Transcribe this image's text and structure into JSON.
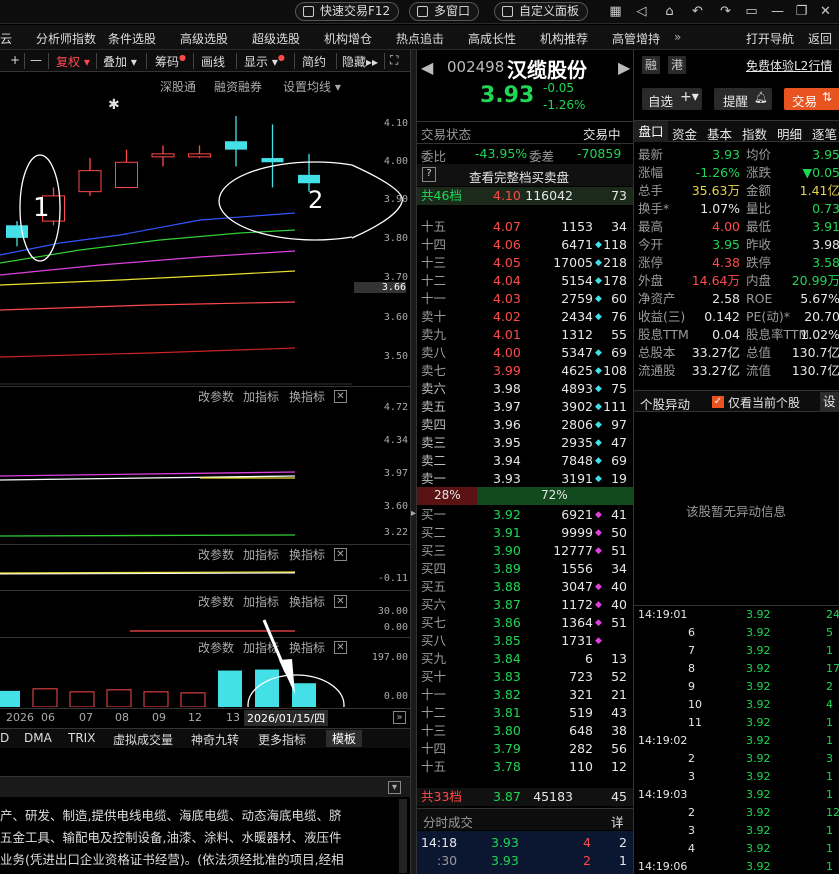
{
  "topbar": {
    "quick_trade": "快速交易F12",
    "multi_window": "多窗口",
    "custom_panel": "自定义面板"
  },
  "menu": {
    "items": [
      "云",
      "分析师指数",
      "条件选股",
      "高级选股",
      "超级选股",
      "机构增仓",
      "热点追击",
      "高成长性",
      "机构推荐",
      "高管增持"
    ],
    "nav": "打开导航",
    "back": "返回"
  },
  "chart_toolbar": {
    "fuquan": "复权",
    "diejia": "叠加",
    "chouma": "筹码",
    "huaxian": "画线",
    "xianshi": "显示",
    "jianyue": "简约",
    "yincang": "隐藏"
  },
  "chart_sub_toolbar": {
    "shengang": "深股通",
    "rongzi": "融资融券",
    "setup_ma": "设置均线"
  },
  "price_axis": [
    "4.10",
    "4.00",
    "3.90",
    "3.80",
    "3.70",
    "3.60",
    "3.50"
  ],
  "price_axis_current": "3.66",
  "indicator_panels": [
    {
      "labels": [
        "改参数",
        "加指标",
        "换指标"
      ],
      "axis": [
        "4.72",
        "4.34",
        "3.97",
        "3.60",
        "3.22"
      ]
    },
    {
      "labels": [
        "改参数",
        "加指标",
        "换指标"
      ],
      "axis": [
        "-0.11"
      ]
    },
    {
      "labels": [
        "改参数",
        "加指标",
        "换指标"
      ],
      "axis": [
        "30.00",
        "0.00"
      ]
    },
    {
      "labels": [
        "改参数",
        "加指标",
        "换指标"
      ],
      "axis": [
        "197.00",
        "0.00"
      ]
    }
  ],
  "date_axis": {
    "labels": [
      "2026",
      "06",
      "07",
      "08",
      "09",
      "12",
      "13"
    ],
    "current_date": "2026/01/15/四"
  },
  "indicator_tabs": [
    "D",
    "DMA",
    "TRIX",
    "虚拟成交量",
    "神奇九转",
    "更多指标",
    "模板"
  ],
  "annotations": {
    "one": "1",
    "two": "2"
  },
  "description": [
    "产、研发、制造,提供电线电缆、海底电缆、动态海底电缆、脐",
    "五金工具、输配电及控制设备,油漆、涂料、水暖器材、液压件",
    "业务(凭进出口企业资格证书经营)。(依法须经批准的项目,经相"
  ],
  "stock": {
    "code": "002498",
    "name": "汉缆股份",
    "price": "3.93",
    "change": "-0.05",
    "change_pct": "-1.26%",
    "tags": [
      "融",
      "港"
    ],
    "l2": "免费体验L2行情"
  },
  "trade_status": {
    "label": "交易状态",
    "value": "交易中",
    "weibi_label": "委比",
    "weibi": "-43.95%",
    "weicha_label": "委差",
    "weicha": "-70859",
    "view_full": "查看完整档买卖盘"
  },
  "sell_summary": {
    "label": "共46档",
    "price": "4.10",
    "volume": "116042",
    "count": "73"
  },
  "asks": [
    {
      "level": "十五",
      "price": "4.07",
      "vol": "1153",
      "count": "34",
      "marker": ""
    },
    {
      "level": "十四",
      "price": "4.06",
      "vol": "6471",
      "count": "118",
      "marker": "◆"
    },
    {
      "level": "十三",
      "price": "4.05",
      "vol": "17005",
      "count": "218",
      "marker": "◆"
    },
    {
      "level": "十二",
      "price": "4.04",
      "vol": "5154",
      "count": "178",
      "marker": "◆"
    },
    {
      "level": "十一",
      "price": "4.03",
      "vol": "2759",
      "count": "60",
      "marker": "◆"
    },
    {
      "level": "卖十",
      "price": "4.02",
      "vol": "2434",
      "count": "76",
      "marker": "◆"
    },
    {
      "level": "卖九",
      "price": "4.01",
      "vol": "1312",
      "count": "55",
      "marker": ""
    },
    {
      "level": "卖八",
      "price": "4.00",
      "vol": "5347",
      "count": "69",
      "marker": "◆"
    },
    {
      "level": "卖七",
      "price": "3.99",
      "vol": "4625",
      "count": "108",
      "marker": "◆"
    },
    {
      "level": "卖六",
      "price": "3.98",
      "vol": "4893",
      "count": "75",
      "marker": "◆"
    },
    {
      "level": "卖五",
      "price": "3.97",
      "vol": "3902",
      "count": "111",
      "marker": "◆"
    },
    {
      "level": "卖四",
      "price": "3.96",
      "vol": "2806",
      "count": "97",
      "marker": "◆"
    },
    {
      "level": "卖三",
      "price": "3.95",
      "vol": "2935",
      "count": "47",
      "marker": "◆"
    },
    {
      "level": "卖二",
      "price": "3.94",
      "vol": "7848",
      "count": "69",
      "marker": "◆"
    },
    {
      "level": "卖一",
      "price": "3.93",
      "vol": "3191",
      "count": "19",
      "marker": "◆"
    }
  ],
  "ratio": {
    "sell": "28%",
    "buy": "72%"
  },
  "bids": [
    {
      "level": "买一",
      "price": "3.92",
      "vol": "6921",
      "count": "41",
      "marker": "◆"
    },
    {
      "level": "买二",
      "price": "3.91",
      "vol": "9999",
      "count": "50",
      "marker": "◆"
    },
    {
      "level": "买三",
      "price": "3.90",
      "vol": "12777",
      "count": "51",
      "marker": "◆"
    },
    {
      "level": "买四",
      "price": "3.89",
      "vol": "1556",
      "count": "34",
      "marker": ""
    },
    {
      "level": "买五",
      "price": "3.88",
      "vol": "3047",
      "count": "40",
      "marker": "◆"
    },
    {
      "level": "买六",
      "price": "3.87",
      "vol": "1172",
      "count": "40",
      "marker": "◆"
    },
    {
      "level": "买七",
      "price": "3.86",
      "vol": "1364",
      "count": "51",
      "marker": "◆"
    },
    {
      "level": "买八",
      "price": "3.85",
      "vol": "1731",
      "count": "",
      "marker": "◆"
    },
    {
      "level": "买九",
      "price": "3.84",
      "vol": "6",
      "count": "13",
      "marker": ""
    },
    {
      "level": "买十",
      "price": "3.83",
      "vol": "723",
      "count": "52",
      "marker": ""
    },
    {
      "level": "十一",
      "price": "3.82",
      "vol": "321",
      "count": "21",
      "marker": ""
    },
    {
      "level": "十二",
      "price": "3.81",
      "vol": "519",
      "count": "43",
      "marker": ""
    },
    {
      "level": "十三",
      "price": "3.80",
      "vol": "648",
      "count": "38",
      "marker": ""
    },
    {
      "level": "十四",
      "price": "3.79",
      "vol": "282",
      "count": "56",
      "marker": ""
    },
    {
      "level": "十五",
      "price": "3.78",
      "vol": "110",
      "count": "12",
      "marker": ""
    }
  ],
  "buy_summary": {
    "label": "共33档",
    "price": "3.87",
    "volume": "45183",
    "count": "45"
  },
  "time_trades": {
    "label": "分时成交",
    "detail": "详",
    "rows": [
      {
        "time": "14:18",
        "price": "3.93",
        "vol": "4",
        "count": "2"
      },
      {
        "time": ":30",
        "price": "3.93",
        "vol": "2",
        "count": "1"
      }
    ]
  },
  "right_buttons": {
    "zixuan": "自选",
    "tixing": "提醒",
    "jiaoyi": "交易"
  },
  "right_tabs": [
    "盘口",
    "资金",
    "基本",
    "指数",
    "明细",
    "逐笔"
  ],
  "quote": [
    {
      "l1": "最新",
      "v1": "3.93",
      "c1": "grn",
      "l2": "均价",
      "v2": "3.95",
      "c2": "grn"
    },
    {
      "l1": "涨幅",
      "v1": "-1.26%",
      "c1": "grn",
      "l2": "涨跌",
      "v2": "▼0.05",
      "c2": "grn"
    },
    {
      "l1": "总手",
      "v1": "35.63万",
      "c1": "yel",
      "l2": "金额",
      "v2": "1.41亿",
      "c2": "yel"
    },
    {
      "l1": "换手*",
      "v1": "1.07%",
      "c1": "wht",
      "l2": "量比",
      "v2": "0.73",
      "c2": "grn"
    },
    {
      "l1": "最高",
      "v1": "4.00",
      "c1": "red",
      "l2": "最低",
      "v2": "3.91",
      "c2": "grn"
    },
    {
      "l1": "今开",
      "v1": "3.95",
      "c1": "grn",
      "l2": "昨收",
      "v2": "3.98",
      "c2": "wht"
    },
    {
      "l1": "涨停",
      "v1": "4.38",
      "c1": "red",
      "l2": "跌停",
      "v2": "3.58",
      "c2": "grn"
    },
    {
      "l1": "外盘",
      "v1": "14.64万",
      "c1": "red",
      "l2": "内盘",
      "v2": "20.99万",
      "c2": "grn"
    },
    {
      "l1": "净资产",
      "v1": "2.58",
      "c1": "wht",
      "l2": "ROE",
      "v2": "5.67%",
      "c2": "wht"
    },
    {
      "l1": "收益(三)",
      "v1": "0.142",
      "c1": "wht",
      "l2": "PE(动)*",
      "v2": "20.70",
      "c2": "wht"
    },
    {
      "l1": "股息TTM",
      "v1": "0.04",
      "c1": "wht",
      "l2": "股息率TTM",
      "v2": "1.02%",
      "c2": "wht"
    },
    {
      "l1": "总股本",
      "v1": "33.27亿",
      "c1": "wht",
      "l2": "总值",
      "v2": "130.7亿",
      "c2": "wht"
    },
    {
      "l1": "流通股",
      "v1": "33.27亿",
      "c1": "wht",
      "l2": "流值",
      "v2": "130.7亿",
      "c2": "wht"
    }
  ],
  "anomaly": {
    "title": "个股异动",
    "only_current": "仅看当前个股",
    "setting": "设",
    "empty": "该股暂无异动信息"
  },
  "ticks": [
    {
      "time": "14:19:01",
      "price": "3.92",
      "vol": "24"
    },
    {
      "time": "6",
      "price": "3.92",
      "vol": "5"
    },
    {
      "time": "7",
      "price": "3.92",
      "vol": "1"
    },
    {
      "time": "8",
      "price": "3.92",
      "vol": "17"
    },
    {
      "time": "9",
      "price": "3.92",
      "vol": "2"
    },
    {
      "time": "10",
      "price": "3.92",
      "vol": "4"
    },
    {
      "time": "11",
      "price": "3.92",
      "vol": "1"
    },
    {
      "time": "14:19:02",
      "price": "3.92",
      "vol": "1"
    },
    {
      "time": "2",
      "price": "3.92",
      "vol": "3"
    },
    {
      "time": "3",
      "price": "3.92",
      "vol": "1"
    },
    {
      "time": "14:19:03",
      "price": "3.92",
      "vol": "1"
    },
    {
      "time": "2",
      "price": "3.92",
      "vol": "12"
    },
    {
      "time": "3",
      "price": "3.92",
      "vol": "1"
    },
    {
      "time": "4",
      "price": "3.92",
      "vol": "1"
    },
    {
      "time": "14:19:06",
      "price": "3.92",
      "vol": "1"
    }
  ],
  "colors": {
    "up": "#ff4a4a",
    "down": "#1fd655",
    "cyan": "#44e0e8",
    "yellow": "#e8d24a",
    "bg": "#000000",
    "panel": "#0d0d0d"
  },
  "chart_data": {
    "type": "candlestick",
    "candles": [
      {
        "open": 3.8,
        "close": 3.83,
        "high": 3.84,
        "low": 3.78,
        "dir": "down"
      },
      {
        "open": 3.84,
        "close": 3.9,
        "high": 3.92,
        "low": 3.83,
        "dir": "up"
      },
      {
        "open": 3.91,
        "close": 3.96,
        "high": 3.99,
        "low": 3.9,
        "dir": "up"
      },
      {
        "open": 3.92,
        "close": 3.98,
        "high": 4.01,
        "low": 3.92,
        "dir": "up"
      },
      {
        "open": 4.0,
        "close": 4.0,
        "high": 4.02,
        "low": 3.97,
        "dir": "up"
      },
      {
        "open": 4.0,
        "close": 4.0,
        "high": 4.02,
        "low": 3.99,
        "dir": "up"
      },
      {
        "open": 4.03,
        "close": 4.01,
        "high": 4.09,
        "low": 3.97,
        "dir": "down"
      },
      {
        "open": 3.99,
        "close": 3.98,
        "high": 4.07,
        "low": 3.92,
        "dir": "down"
      },
      {
        "open": 3.95,
        "close": 3.93,
        "high": 4.0,
        "low": 3.91,
        "dir": "down"
      }
    ],
    "ylim": [
      3.45,
      4.14
    ],
    "volumes": [
      20,
      24,
      18,
      22,
      18,
      16,
      60,
      62,
      35
    ],
    "volume_ylim": [
      0,
      197
    ]
  }
}
